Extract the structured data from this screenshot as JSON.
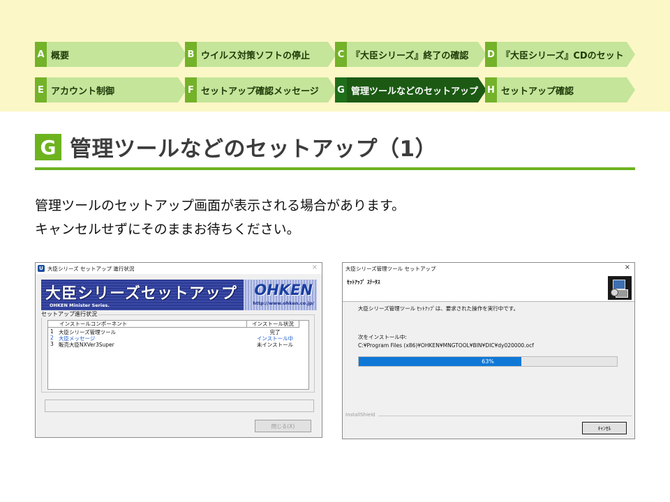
{
  "nav": {
    "steps": [
      {
        "letter": "A",
        "label": "概要"
      },
      {
        "letter": "B",
        "label": "ウイルス対策ソフトの停止"
      },
      {
        "letter": "C",
        "label": "『大臣シリーズ』終了の確認"
      },
      {
        "letter": "D",
        "label": "『大臣シリーズ』CDのセット"
      },
      {
        "letter": "E",
        "label": "アカウント制御"
      },
      {
        "letter": "F",
        "label": "セットアップ確認メッセージ"
      },
      {
        "letter": "G",
        "label": "管理ツールなどのセットアップ",
        "active": true
      },
      {
        "letter": "H",
        "label": "セットアップ確認"
      }
    ]
  },
  "section": {
    "badge": "G",
    "title": "管理ツールなどのセットアップ（1）"
  },
  "description": {
    "line1": "管理ツールのセットアップ画面が表示される場合があります。",
    "line2": "キャンセルせずにそのままお待ちください。"
  },
  "dialog1": {
    "title": "大臣シリーズ セットアップ 進行状況",
    "close_glyph": "×",
    "banner_title": "大臣シリーズセットアップ",
    "banner_sub": "OHKEN Minister Series.",
    "logo": "OHKEN",
    "url": "http://www.ohken.co.jp/",
    "group_label": "セットアップ進行状況",
    "col_component": "インストールコンポーネント",
    "col_status": "インストール状況",
    "rows": [
      {
        "num": "1",
        "name": "大臣シリーズ管理ツール",
        "status": "完了"
      },
      {
        "num": "2",
        "name": "大臣メッセージ",
        "status": "インストール中",
        "highlight": true
      },
      {
        "num": "3",
        "name": "販売大臣NXVer3Super",
        "status": "未インストール"
      }
    ],
    "close_button": "閉じる(X)"
  },
  "dialog2": {
    "title": "大臣シリーズ管理ツール セットアップ",
    "close_glyph": "×",
    "header_title": "ｾｯﾄｱｯﾌﾟ ｽﾃｰﾀｽ",
    "message": "大臣シリーズ管理ツール ｾｯﾄｱｯﾌﾟは、要求された操作を実行中です。",
    "installing_label": "次をインストール中:",
    "installing_path": "C:¥Program Files (x86)¥OHKEN¥MNGTOOL¥BIN¥DIC¥dy020000.ocf",
    "progress_label": "63%",
    "progress_value": 0.63,
    "installshield": "InstallShield",
    "cancel_button": "ｷｬﾝｾﾙ"
  }
}
